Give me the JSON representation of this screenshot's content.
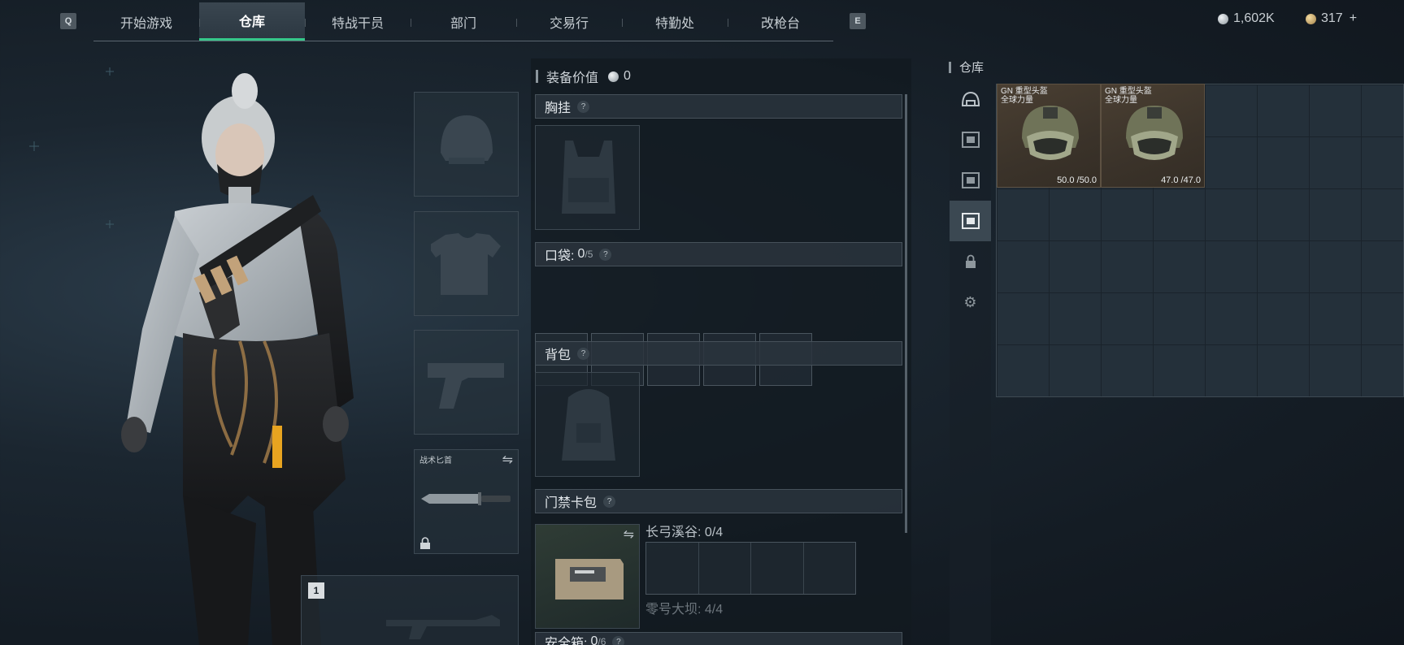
{
  "top_nav": {
    "left_key": "Q",
    "right_key": "E",
    "tabs": [
      {
        "label": "开始游戏",
        "active": false
      },
      {
        "label": "仓库",
        "active": true
      },
      {
        "label": "特战干员",
        "active": false
      },
      {
        "label": "部门",
        "active": false
      },
      {
        "label": "交易行",
        "active": false
      },
      {
        "label": "特勤处",
        "active": false
      },
      {
        "label": "改枪台",
        "active": false
      }
    ]
  },
  "currency": {
    "silver": "1,602K",
    "gold": "317",
    "add_symbol": "+"
  },
  "equipment": {
    "melee_slot_label": "战术匕首",
    "primary_slot_number": "1"
  },
  "loadout_panel": {
    "equip_value_label": "装备价值",
    "equip_value": "0",
    "chest_rig_label": "胸挂",
    "pocket_label": "口袋:",
    "pocket_count": "0",
    "pocket_capacity": "/5",
    "backpack_label": "背包",
    "keycard_label": "门禁卡包",
    "keycard_maps": [
      {
        "name": "长弓溪谷: 0/4"
      },
      {
        "name": "零号大坝: 4/4"
      }
    ],
    "safebox_label": "安全箱:",
    "safebox_count": "0",
    "safebox_capacity": "/6",
    "help_symbol": "?"
  },
  "warehouse": {
    "title": "仓库",
    "items": [
      {
        "name_line1": "GN 重型头盔",
        "name_line2": "全球力量",
        "durability": "50.0 /50.0"
      },
      {
        "name_line1": "GN 重型头盔",
        "name_line2": "全球力量",
        "durability": "47.0 /47.0"
      }
    ]
  },
  "colors": {
    "accent_green": "#36c78a",
    "item_brown": "#4a3f32"
  }
}
